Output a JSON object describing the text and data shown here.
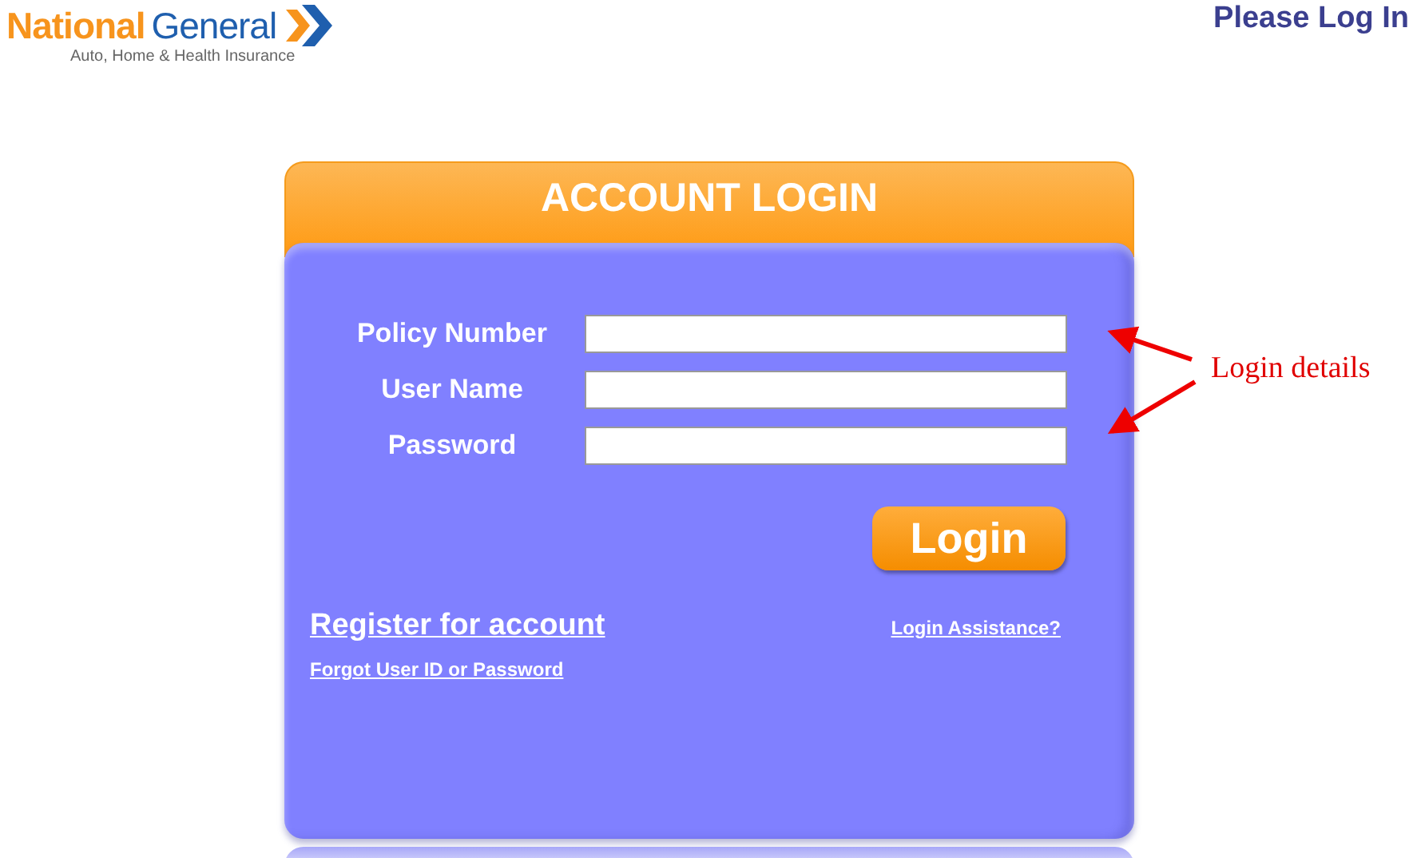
{
  "logo": {
    "brand_first": "National",
    "brand_second": "General",
    "tagline": "Auto, Home & Health Insurance"
  },
  "header_title": "Please Log In",
  "login_card": {
    "title": "ACCOUNT LOGIN",
    "fields": [
      {
        "label": "Policy Number"
      },
      {
        "label": "User Name"
      },
      {
        "label": "Password"
      }
    ],
    "submit_button": "Login",
    "register_link": "Register for account",
    "forgot_link": "Forgot User ID or Password",
    "assistance_link": "Login Assistance?"
  },
  "annotation": {
    "label": "Login details"
  }
}
